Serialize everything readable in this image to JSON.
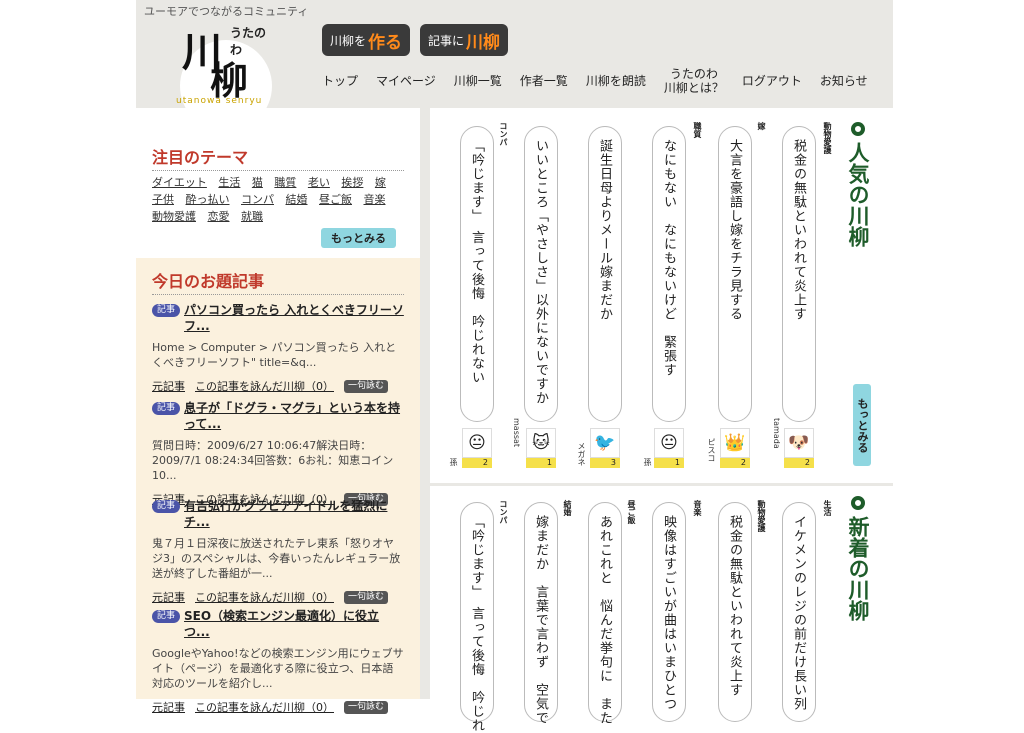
{
  "header": {
    "tagline": "ユーモアでつながるコミュニティ",
    "logo": {
      "kanji_1": "川",
      "kanji_2": "柳",
      "kana": "うたのわ",
      "roman": "utanowa senryu"
    },
    "buttons": [
      {
        "prefix": "川柳を",
        "accent": "作る"
      },
      {
        "prefix": "記事に",
        "accent": "川柳"
      }
    ],
    "nav": [
      {
        "label": "トップ"
      },
      {
        "label": "マイページ"
      },
      {
        "label": "川柳一覧"
      },
      {
        "label": "作者一覧"
      },
      {
        "label": "川柳を朗読"
      },
      {
        "label": "うたのわ\n川柳とは？"
      },
      {
        "label": "ログアウト"
      },
      {
        "label": "お知らせ"
      }
    ]
  },
  "themes": {
    "title": "注目のテーマ",
    "tags": [
      "ダイエット",
      "生活",
      "猫",
      "職質",
      "老い",
      "挨拶",
      "嫁",
      "子供",
      "酔っ払い",
      "コンパ",
      "結婚",
      "昼ご飯",
      "音楽",
      "動物愛護",
      "恋愛",
      "就職"
    ],
    "more": "もっとみる"
  },
  "articles": {
    "title": "今日のお題記事",
    "badge": "記事",
    "footer_link_1": "元記事",
    "footer_link_2": "この記事を詠んだ川柳（0）",
    "footer_btn": "一句詠む",
    "items": [
      {
        "title": "パソコン買ったら 入れとくべきフリーソフ...",
        "desc": "Home > Computer > パソコン買ったら 入れとくべきフリーソフト\" title=&q..."
      },
      {
        "title": "息子が「ドグラ・マグラ」という本を持って...",
        "desc": "質問日時：2009/6/27 10:06:47解決日時：2009/7/1 08:24:34回答数：6お礼：知恵コイン10..."
      },
      {
        "title": "有吉弘行がグラビアアイドルを猛烈にチ...",
        "desc": "鬼７月１日深夜に放送されたテレ東系「怒りオヤジ3」のスペシャルは、今春いったんレギュラー放送が終了した番組が一..."
      },
      {
        "title": "SEO（検索エンジン最適化）に役立つ...",
        "desc": "GoogleやYahoo!などの検索エンジン用にウェブサイト（ページ）を最適化する際に役立つ、日本語対応のツールを紹介し..."
      }
    ]
  },
  "popular": {
    "ring": "○",
    "title": "人気の川柳",
    "more": "もっとみる",
    "cards": [
      {
        "category": "動物愛護",
        "verse": "税金の無駄といわれて炎上す",
        "author": "tamada",
        "count": "2",
        "avatar": "🐶"
      },
      {
        "category": "嫁",
        "verse": "大言を豪語し嫁をチラ見する",
        "author": "ピスコ",
        "count": "2",
        "avatar": "👑"
      },
      {
        "category": "職質",
        "verse": "なにもない　なにもないけど　緊張す",
        "author": "孫",
        "count": "1",
        "avatar": "😐"
      },
      {
        "category": "",
        "verse": "誕生日母よりメール嫁まだか",
        "author": "メガネ",
        "count": "3",
        "avatar": "🐦"
      },
      {
        "category": "",
        "verse": "いいところ「やさしさ」以外にないですか",
        "author": "massat",
        "count": "1",
        "avatar": "🐱"
      },
      {
        "category": "コンパ",
        "verse": "「吟じます」　言って後悔　吟じれない",
        "author": "孫",
        "count": "2",
        "avatar": "😐"
      }
    ]
  },
  "newest": {
    "ring": "○",
    "title": "新着の川柳",
    "cards": [
      {
        "category": "生活",
        "verse": "イケメンのレジの前だけ長い列"
      },
      {
        "category": "動物愛護",
        "verse": "税金の無駄といわれて炎上す"
      },
      {
        "category": "音楽",
        "verse": "映像はすごいが曲はいまひとつ"
      },
      {
        "category": "昼ご飯",
        "verse": "あれこれと　悩んだ挙句に　また"
      },
      {
        "category": "結婚",
        "verse": "嫁まだか　言葉で言わず　空気で"
      },
      {
        "category": "コンパ",
        "verse": "「吟じます」　言って後悔　吟じれ"
      }
    ]
  }
}
